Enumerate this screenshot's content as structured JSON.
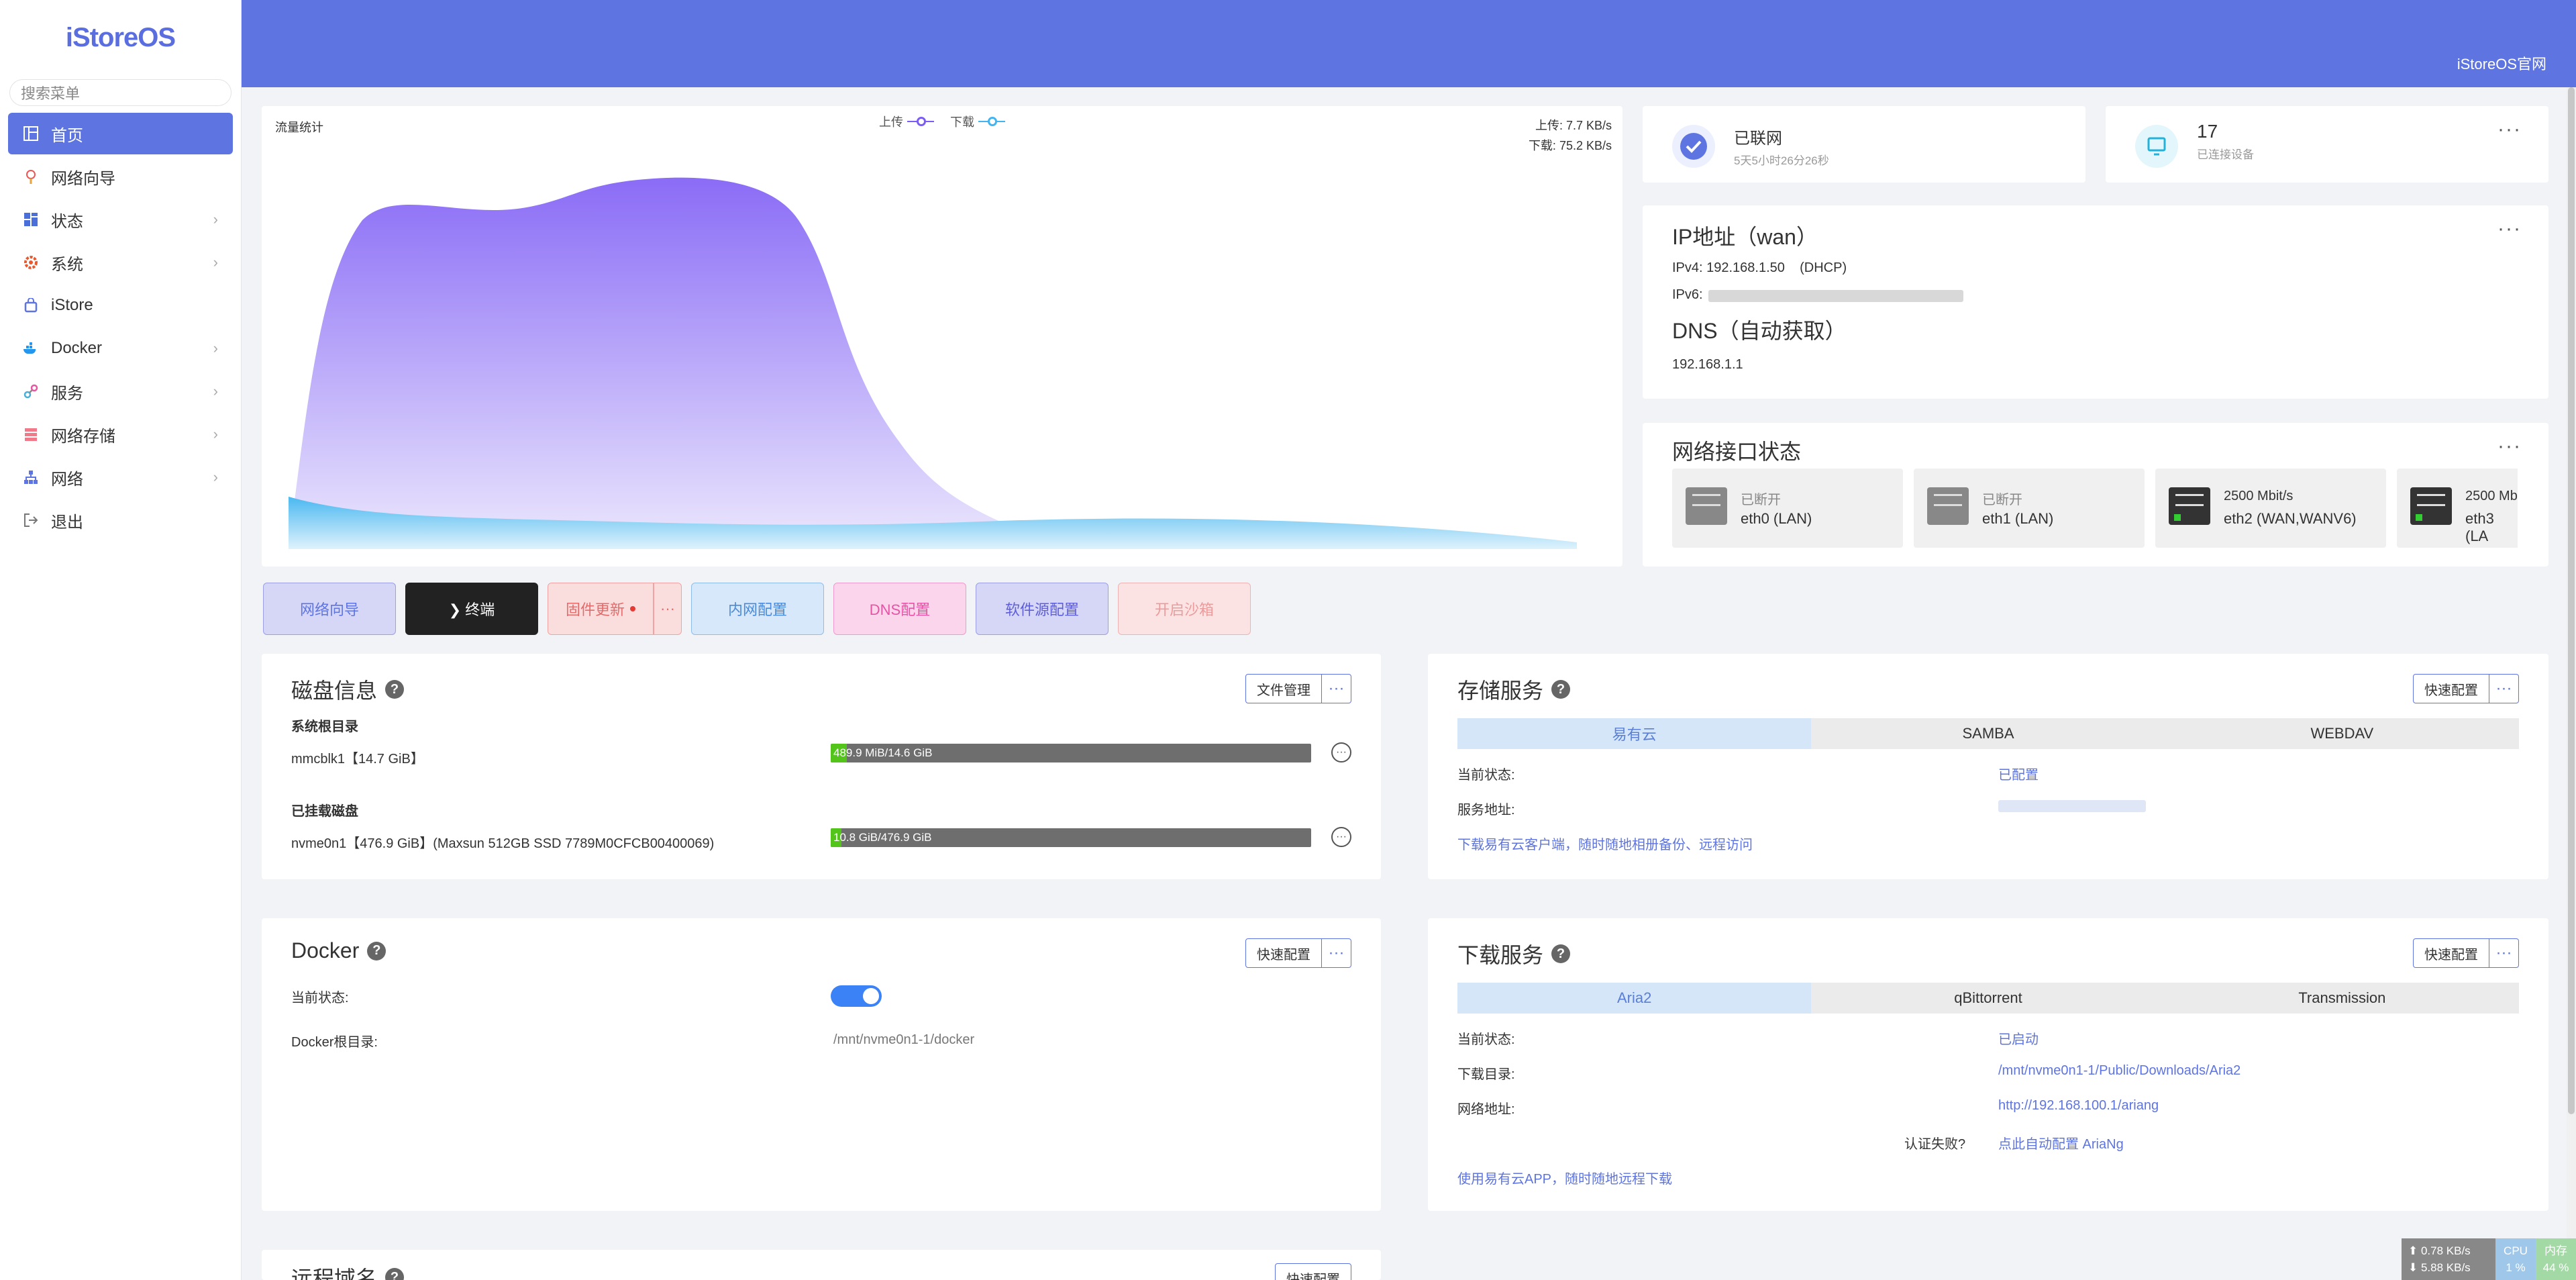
{
  "sidebar": {
    "logo": "iStoreOS",
    "search_placeholder": "搜索菜单",
    "items": [
      {
        "label": "首页",
        "icon": "dashboard-icon",
        "chevron": ""
      },
      {
        "label": "网络向导",
        "icon": "wizard-icon",
        "chevron": ""
      },
      {
        "label": "状态",
        "icon": "status-icon",
        "chevron": "›"
      },
      {
        "label": "系统",
        "icon": "gear-icon",
        "chevron": "›"
      },
      {
        "label": "iStore",
        "icon": "store-icon",
        "chevron": ""
      },
      {
        "label": "Docker",
        "icon": "docker-icon",
        "chevron": "›"
      },
      {
        "label": "服务",
        "icon": "services-icon",
        "chevron": "›"
      },
      {
        "label": "网络存储",
        "icon": "storage-icon",
        "chevron": "›"
      },
      {
        "label": "网络",
        "icon": "network-icon",
        "chevron": "›"
      },
      {
        "label": "退出",
        "icon": "logout-icon",
        "chevron": ""
      }
    ]
  },
  "topbar": {
    "site_link": "iStoreOS官网"
  },
  "traffic": {
    "title": "流量统计",
    "legend_upload": "上传",
    "legend_download": "下载",
    "upload_rate": "上传: 7.7 KB/s",
    "download_rate": "下载: 75.2 KB/s",
    "colors": {
      "upload": "#7b5cf5",
      "download": "#42b4f0"
    }
  },
  "status": {
    "connected_title": "已联网",
    "connected_sub": "5天5小时26分26秒",
    "devices_count": "17",
    "devices_sub": "已连接设备",
    "more": "···"
  },
  "ip": {
    "title": "IP地址（wan）",
    "ipv4": "IPv4: 192.168.1.50    (DHCP)",
    "ipv6_label": "IPv6:",
    "dns_title": "DNS（自动获取）",
    "dns_value": "192.168.1.1",
    "more": "···"
  },
  "interfaces": {
    "title": "网络接口状态",
    "more": "···",
    "items": [
      {
        "status": "已断开",
        "name": "eth0 (LAN)"
      },
      {
        "status": "已断开",
        "name": "eth1 (LAN)"
      },
      {
        "status": "2500 Mbit/s",
        "name": "eth2 (WAN,WANV6)"
      },
      {
        "status": "2500 Mb",
        "name": "eth3 (LA"
      }
    ]
  },
  "quick_buttons": {
    "wizard": "网络向导",
    "terminal": "❯ 终端",
    "firmware": "固件更新",
    "firmware_more": "···",
    "lan": "内网配置",
    "dns": "DNS配置",
    "source": "软件源配置",
    "sandbox": "开启沙箱"
  },
  "disk": {
    "title": "磁盘信息",
    "file_mgr": "文件管理",
    "more": "···",
    "root_title": "系统根目录",
    "root_name": "mmcblk1【14.7 GiB】",
    "root_usage": "489.9 MiB/14.6 GiB",
    "root_fraction": 0.033,
    "mounted_title": "已挂载磁盘",
    "mounted_name": "nvme0n1【476.9 GiB】(Maxsun 512GB SSD 7789M0CFCB00400069)",
    "mounted_usage": "10.8 GiB/476.9 GiB",
    "mounted_fraction": 0.023,
    "row_more": "···"
  },
  "storage_service": {
    "title": "存储服务",
    "quick": "快速配置",
    "more": "···",
    "tabs": [
      "易有云",
      "SAMBA",
      "WEBDAV"
    ],
    "state_label": "当前状态:",
    "state_value": "已配置",
    "addr_label": "服务地址:",
    "link": "下载易有云客户端，随时随地相册备份、远程访问"
  },
  "docker": {
    "title": "Docker",
    "quick": "快速配置",
    "more": "···",
    "state_label": "当前状态:",
    "root_label": "Docker根目录:",
    "root_value": "/mnt/nvme0n1-1/docker",
    "enabled": true
  },
  "download_service": {
    "title": "下载服务",
    "quick": "快速配置",
    "more": "···",
    "tabs": [
      "Aria2",
      "qBittorrent",
      "Transmission"
    ],
    "state_label": "当前状态:",
    "state_value": "已启动",
    "dir_label": "下载目录:",
    "dir_value": "/mnt/nvme0n1-1/Public/Downloads/Aria2",
    "url_label": "网络地址:",
    "url_value": "http://192.168.100.1/ariang",
    "auth_label": "认证失败?",
    "auth_value": "点此自动配置 AriaNg",
    "link": "使用易有云APP，随时随地远程下载"
  },
  "remote": {
    "title": "远程域名",
    "quick": "快速配置"
  },
  "sysmon": {
    "up": "⬆  0.78 KB/s",
    "down": "⬇  5.88 KB/s",
    "cpu_label": "CPU",
    "cpu_value": "1 %",
    "mem_label": "内存",
    "mem_value": "44 %"
  }
}
